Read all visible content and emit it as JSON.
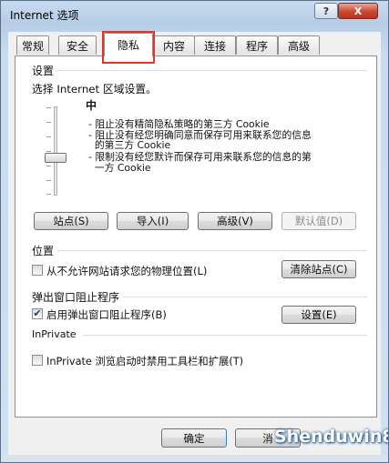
{
  "window": {
    "title": "Internet 选项",
    "help_glyph": "?",
    "close_glyph": "X"
  },
  "tabs": [
    {
      "label": "常规"
    },
    {
      "label": "安全"
    },
    {
      "label": "隐私"
    },
    {
      "label": "内容"
    },
    {
      "label": "连接"
    },
    {
      "label": "程序"
    },
    {
      "label": "高级"
    }
  ],
  "active_tab": "隐私",
  "highlight_color": "#e0352b",
  "settings": {
    "heading": "设置",
    "prompt": "选择 Internet 区域设置。",
    "level": "中",
    "slider_level_fraction": 0.5,
    "description": [
      "- 阻止没有精简隐私策略的第三方 Cookie",
      "- 阻止没有经您明确同意而保存可用来联系您的信息",
      "  的第三方 Cookie",
      "- 限制没有经您默许而保存可用来联系您的信息的第",
      "  一方 Cookie"
    ],
    "buttons": {
      "sites": "站点(S)",
      "import": "导入(I)",
      "advanced": "高级(V)",
      "default": "默认值(D)"
    }
  },
  "location": {
    "heading": "位置",
    "never_allow_label": "从不允许网站请求您的物理位置(L)",
    "never_allow_checked": false,
    "clear_sites": "清除站点(C)"
  },
  "popup": {
    "heading": "弹出窗口阻止程序",
    "enable_label": "启用弹出窗口阻止程序(B)",
    "enable_checked": true,
    "settings_button": "设置(E)"
  },
  "inprivate": {
    "heading": "InPrivate",
    "disable_toolbars_label": "InPrivate 浏览启动时禁用工具栏和扩展(T)",
    "disable_toolbars_checked": false
  },
  "footer": {
    "ok": "确定",
    "cancel": "消"
  },
  "check_glyph": "✔",
  "watermark": "Shenduwin8.com"
}
